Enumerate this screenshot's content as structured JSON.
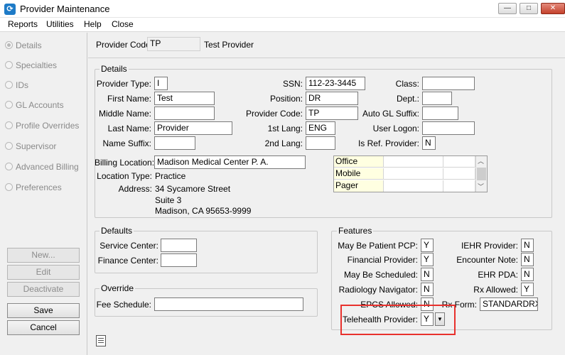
{
  "window": {
    "title": "Provider Maintenance",
    "icon": "app-logo-icon"
  },
  "menu": {
    "items": [
      "Reports",
      "Utilities",
      "Help",
      "Close"
    ]
  },
  "sidebar": {
    "items": [
      "Details",
      "Specialties",
      "IDs",
      "GL Accounts",
      "Profile Overrides",
      "Supervisor",
      "Advanced Billing",
      "Preferences"
    ],
    "selected": "Details",
    "buttons": {
      "new": "New...",
      "edit": "Edit",
      "deactivate": "Deactivate",
      "save": "Save",
      "cancel": "Cancel"
    }
  },
  "header": {
    "provider_code_label": "Provider Code:",
    "provider_code": "TP",
    "provider_name": "Test Provider"
  },
  "details": {
    "title": "Details",
    "provider_type_label": "Provider Type:",
    "provider_type": "I",
    "first_name_label": "First Name:",
    "first_name": "Test",
    "middle_name_label": "Middle Name:",
    "middle_name": "",
    "last_name_label": "Last Name:",
    "last_name": "Provider",
    "name_suffix_label": "Name Suffix:",
    "name_suffix": "",
    "ssn_label": "SSN:",
    "ssn": "112-23-3445",
    "position_label": "Position:",
    "position": "DR",
    "provider_code_label": "Provider Code:",
    "provider_code": "TP",
    "first_lang_label": "1st Lang:",
    "first_lang": "ENG",
    "second_lang_label": "2nd Lang:",
    "second_lang": "",
    "class_label": "Class:",
    "class": "",
    "dept_label": "Dept.:",
    "dept": "",
    "auto_gl_label": "Auto GL Suffix:",
    "auto_gl": "",
    "user_logon_label": "User Logon:",
    "user_logon": "",
    "is_ref_label": "Is Ref. Provider:",
    "is_ref": "N",
    "billing_location_label": "Billing Location:",
    "billing_location": "Madison Medical Center P. A.",
    "location_type_label": "Location Type:",
    "location_type": "Practice",
    "address_label": "Address:",
    "address_lines": [
      "34 Sycamore Street",
      "Suite 3",
      "Madison, CA 95653-9999"
    ],
    "phones": [
      {
        "type": "Office",
        "number": "",
        "ext": ""
      },
      {
        "type": "Mobile",
        "number": "",
        "ext": ""
      },
      {
        "type": "Pager",
        "number": "",
        "ext": ""
      }
    ]
  },
  "defaults": {
    "title": "Defaults",
    "service_center_label": "Service Center:",
    "service_center": "",
    "finance_center_label": "Finance Center:",
    "finance_center": ""
  },
  "override": {
    "title": "Override",
    "fee_schedule_label": "Fee Schedule:",
    "fee_schedule": ""
  },
  "features": {
    "title": "Features",
    "may_be_pcp_label": "May Be Patient PCP:",
    "may_be_pcp": "Y",
    "financial_provider_label": "Financial Provider:",
    "financial_provider": "Y",
    "may_be_scheduled_label": "May Be Scheduled:",
    "may_be_scheduled": "N",
    "radiology_nav_label": "Radiology Navigator:",
    "radiology_nav": "N",
    "epcs_label": "EPCS Allowed:",
    "epcs": "N",
    "telehealth_label": "Telehealth Provider:",
    "telehealth": "Y",
    "iehr_label": "IEHR Provider:",
    "iehr": "N",
    "encounter_note_label": "Encounter Note:",
    "encounter_note": "N",
    "ehr_pda_label": "EHR PDA:",
    "ehr_pda": "N",
    "rx_allowed_label": "Rx Allowed:",
    "rx_allowed": "Y",
    "rx_form_label": "Rx Form:",
    "rx_form": "STANDARDRX"
  },
  "colors": {
    "highlight": "#e8312d",
    "phone_type_bg": "#ffffe1",
    "accent": "#1e7bc7"
  }
}
